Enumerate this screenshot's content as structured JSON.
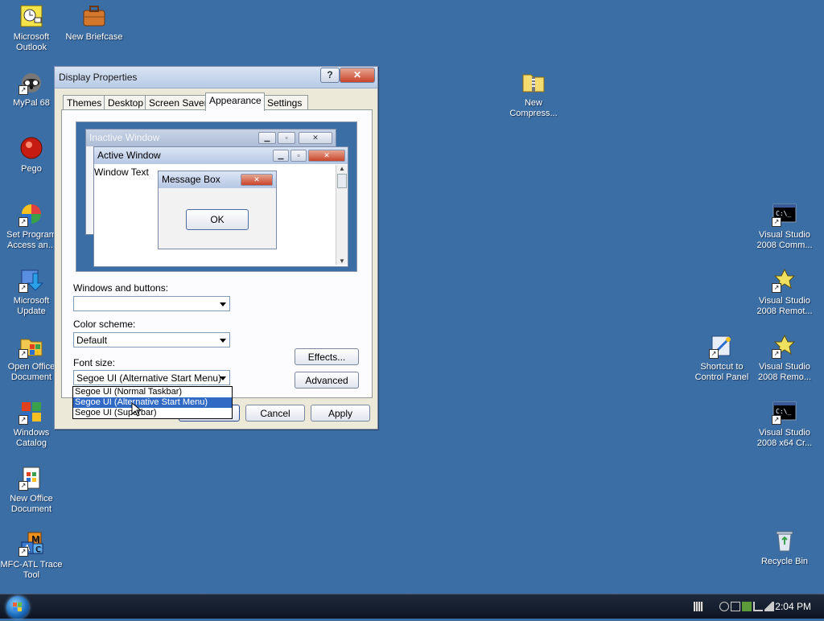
{
  "desktop": {
    "icons": [
      {
        "name": "outlook-icon",
        "label": "Microsoft\nOutlook"
      },
      {
        "name": "briefcase-icon",
        "label": "New Briefcase"
      },
      {
        "name": "mypal-icon",
        "label": "MyPal 68"
      },
      {
        "name": "pego-icon",
        "label": "Pego"
      },
      {
        "name": "set-program-access-icon",
        "label": "Set Program\nAccess an..."
      },
      {
        "name": "microsoft-update-icon",
        "label": "Microsoft\nUpdate"
      },
      {
        "name": "open-office-document-icon",
        "label": "Open Office\nDocument"
      },
      {
        "name": "windows-catalog-icon",
        "label": "Windows\nCatalog"
      },
      {
        "name": "new-office-document-icon",
        "label": "New Office\nDocument"
      },
      {
        "name": "mfc-atl-trace-icon",
        "label": "MFC-ATL Trace\nTool"
      },
      {
        "name": "compressed-folder-icon",
        "label": "New\nCompress..."
      },
      {
        "name": "vs2008-command-prompt-icon",
        "label": "Visual Studio\n2008 Comm..."
      },
      {
        "name": "vs2008-remote-debugger-icon",
        "label": "Visual Studio\n2008 Remot..."
      },
      {
        "name": "control-panel-shortcut-icon",
        "label": "Shortcut to\nControl Panel"
      },
      {
        "name": "vs2008-remote-debugger-2-icon",
        "label": "Visual Studio\n2008 Remo..."
      },
      {
        "name": "vs2008-x64-command-icon",
        "label": "Visual Studio\n2008 x64 Cr..."
      },
      {
        "name": "recycle-bin-icon",
        "label": "Recycle Bin"
      }
    ]
  },
  "taskbar": {
    "clock": "2:04 PM"
  },
  "dialog": {
    "title": "Display Properties",
    "help_glyph": "?",
    "close_glyph": "✕",
    "tabs": [
      "Themes",
      "Desktop",
      "Screen Saver",
      "Appearance",
      "Settings"
    ],
    "selected_tab": "Appearance",
    "preview": {
      "inactive_title": "Inactive Window",
      "active_title": "Active Window",
      "window_text": "Window Text",
      "message_box_title": "Message Box",
      "ok_label": "OK"
    },
    "windows_buttons_label": "Windows and buttons:",
    "windows_buttons_value": "",
    "color_scheme_label": "Color scheme:",
    "color_scheme_value": "Default",
    "font_size_label": "Font size:",
    "font_size_value": "Segoe UI (Alternative Start Menu)",
    "font_size_options": [
      "Segoe UI (Normal Taskbar)",
      "Segoe UI (Alternative Start Menu)",
      "Segoe UI (Superbar)"
    ],
    "highlighted_option_index": 1,
    "effects_label": "Effects...",
    "advanced_label": "Advanced",
    "cancel_label": "Cancel",
    "apply_label": "Apply"
  },
  "colors": {
    "desktop": "#3a6ea5",
    "selection": "#316ac5",
    "dialog_face": "#ece9d8"
  }
}
